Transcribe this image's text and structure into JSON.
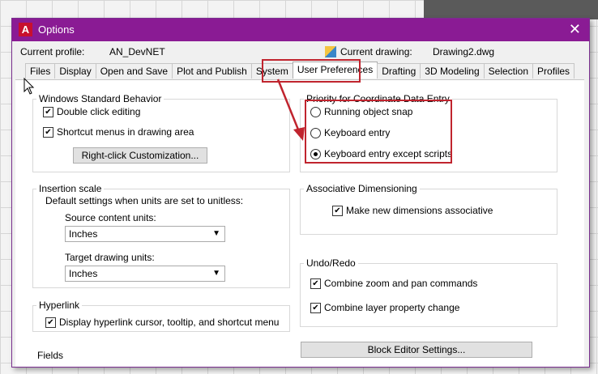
{
  "window": {
    "title": "Options",
    "close_icon": "close-icon"
  },
  "profile": {
    "label": "Current profile:",
    "value": "AN_DevNET"
  },
  "drawing": {
    "label": "Current drawing:",
    "value": "Drawing2.dwg"
  },
  "tabs": [
    "Files",
    "Display",
    "Open and Save",
    "Plot and Publish",
    "System",
    "User Preferences",
    "Drafting",
    "3D Modeling",
    "Selection",
    "Profiles"
  ],
  "active_tab": "User Preferences",
  "windows_behavior": {
    "title": "Windows Standard Behavior",
    "double_click": "Double click editing",
    "shortcut_menus": "Shortcut menus in drawing area",
    "right_click_button": "Right-click Customization..."
  },
  "insertion_scale": {
    "title": "Insertion scale",
    "desc": "Default settings when units are set to unitless:",
    "source_label": "Source content units:",
    "source_value": "Inches",
    "target_label": "Target drawing units:",
    "target_value": "Inches"
  },
  "hyperlink": {
    "title": "Hyperlink",
    "display": "Display hyperlink cursor, tooltip, and shortcut menu"
  },
  "fields_title": "Fields",
  "coordinate_priority": {
    "title": "Priority for Coordinate Data Entry",
    "options": [
      "Running object snap",
      "Keyboard entry",
      "Keyboard entry except scripts"
    ],
    "selected": "Keyboard entry except scripts"
  },
  "assoc_dim": {
    "title": "Associative Dimensioning",
    "make_associative": "Make new dimensions associative"
  },
  "undo_redo": {
    "title": "Undo/Redo",
    "combine_zoom": "Combine zoom and pan commands",
    "combine_layer": "Combine layer property change"
  },
  "block_editor_button": "Block Editor Settings...",
  "colors": {
    "titlebar": "#8a1b94",
    "highlight": "#c0242e"
  }
}
